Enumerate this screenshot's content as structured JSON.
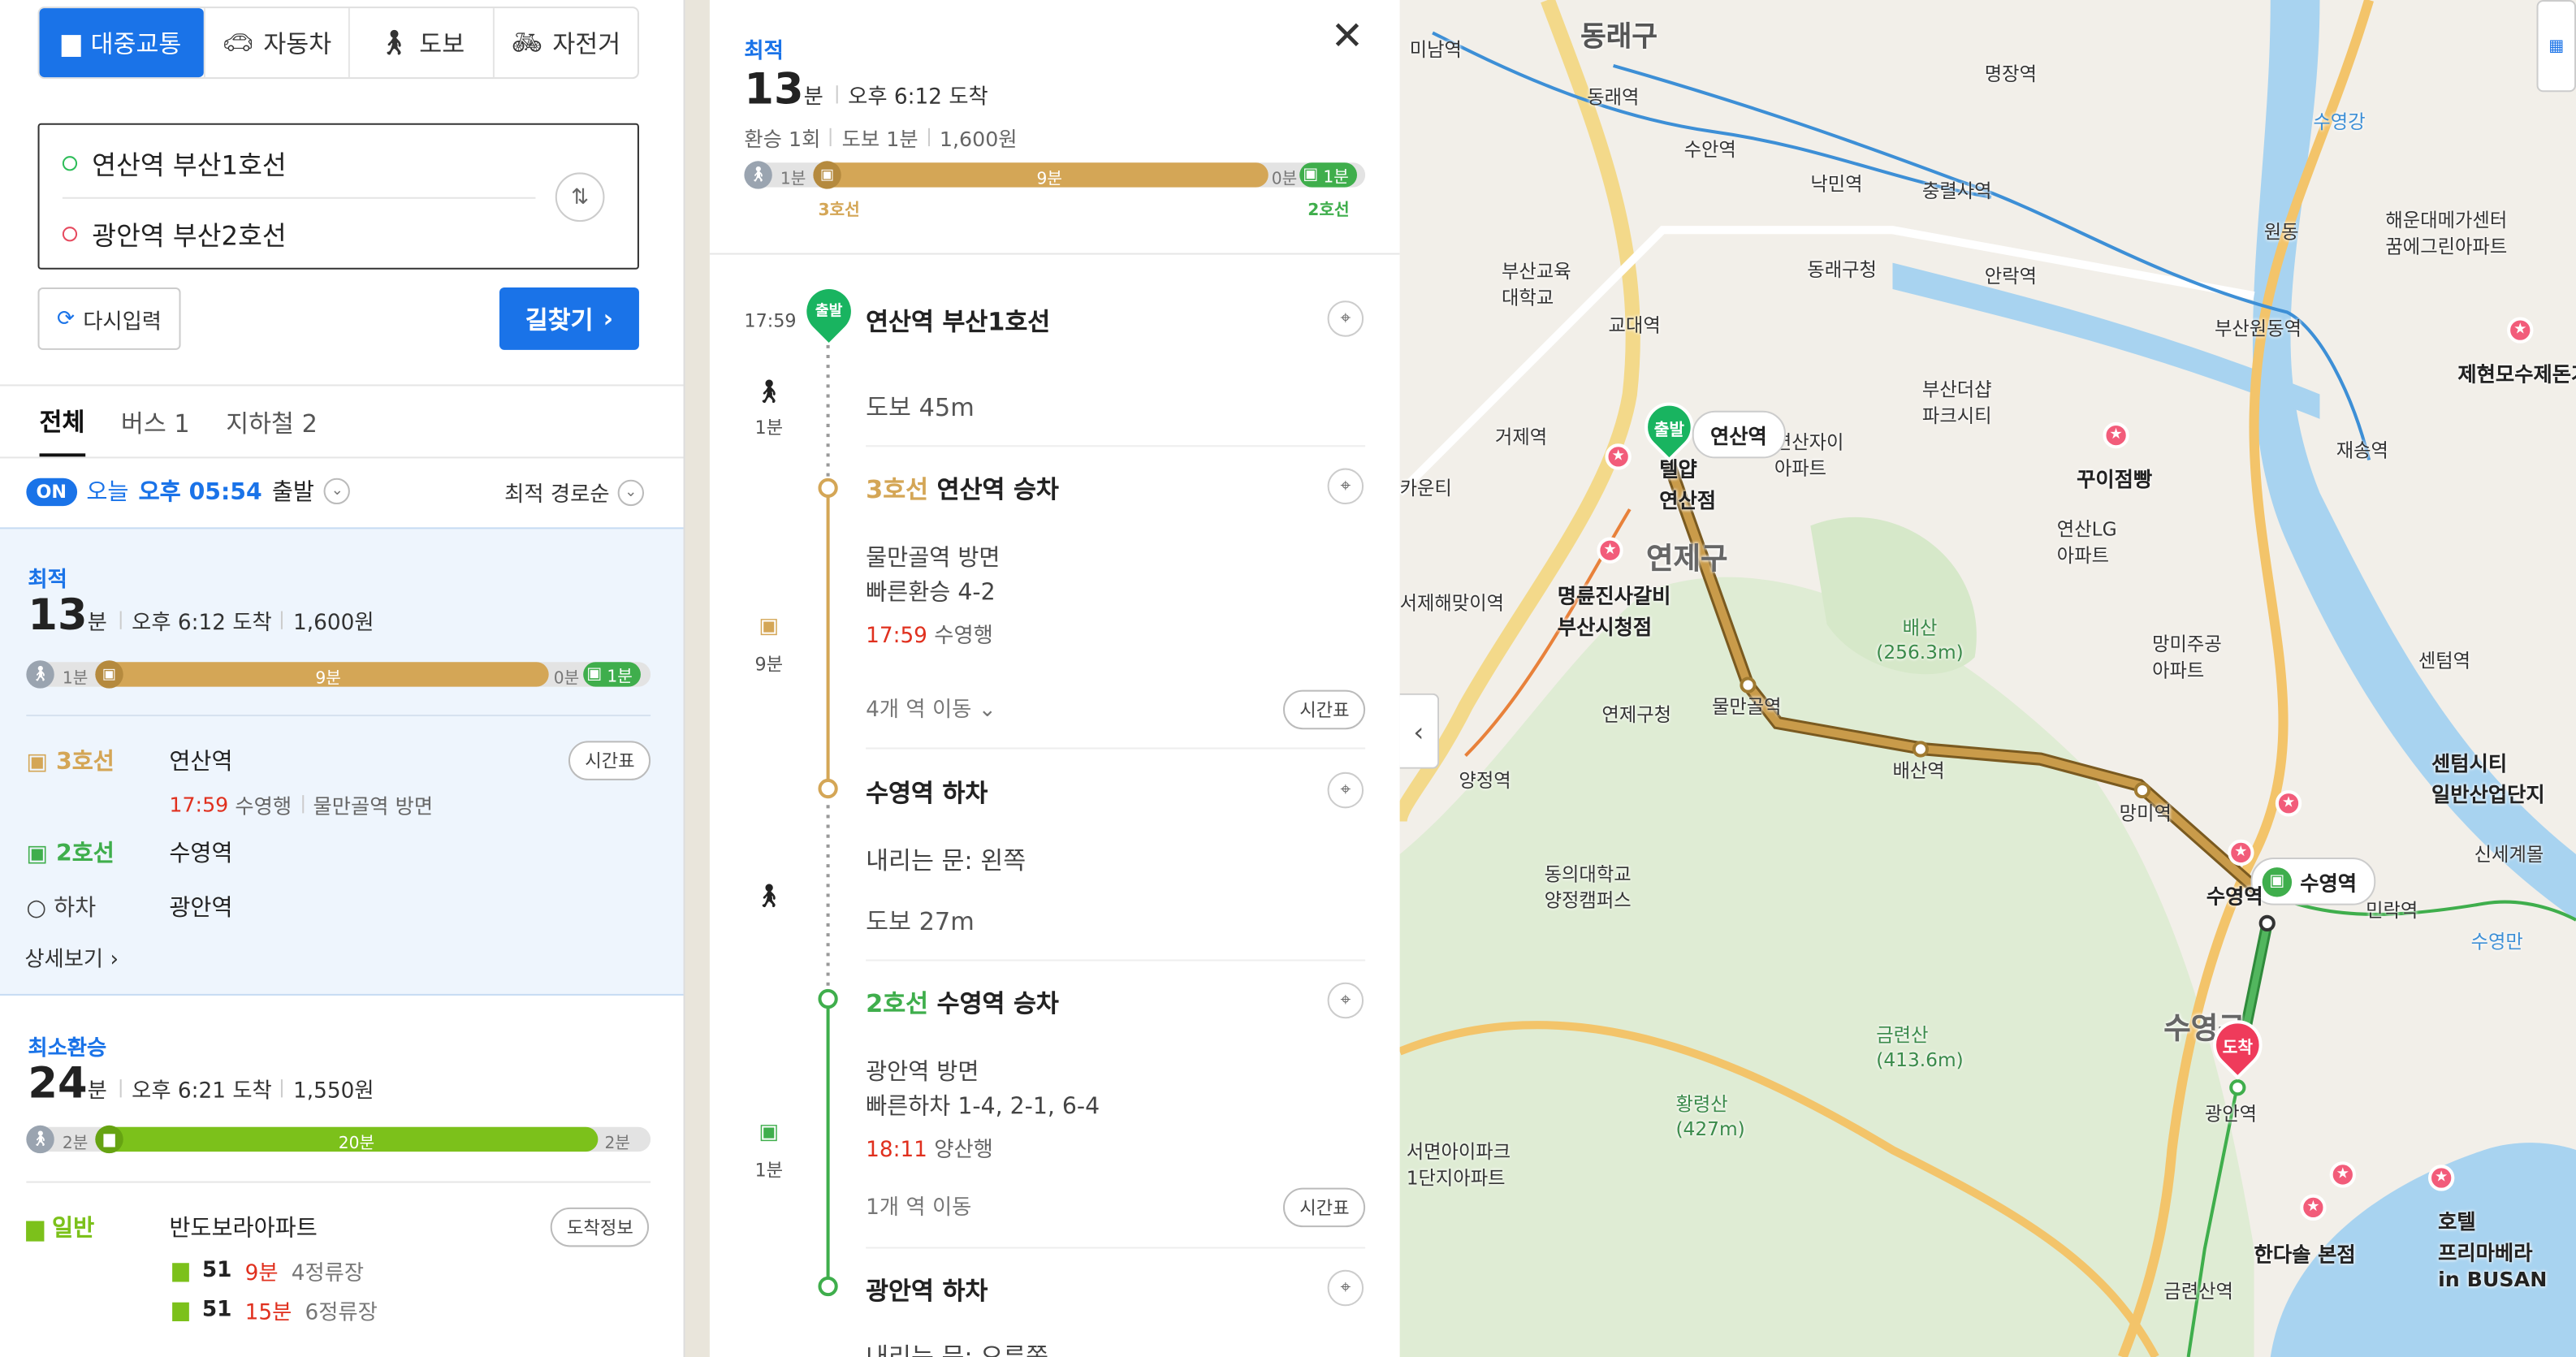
{
  "modes": [
    {
      "icon": "bus-icon",
      "label": "대중교통"
    },
    {
      "icon": "car-icon",
      "label": "자동차"
    },
    {
      "icon": "walk-icon",
      "label": "도보"
    },
    {
      "icon": "bicycle-icon",
      "label": "자전거"
    }
  ],
  "route": {
    "origin": "연산역 부산1호선",
    "destination": "광안역 부산2호선",
    "reset_label": "다시입력",
    "search_label": "길찾기"
  },
  "tabs": [
    "전체",
    "버스 1",
    "지하철 2"
  ],
  "departure": {
    "on": "ON",
    "text_today": "오늘",
    "time": "오후 05:54",
    "suffix": "출발",
    "sort": "최적 경로순"
  },
  "colors": {
    "blue": "#1a73e8",
    "line3": "#d4a656",
    "line2": "#3fae4c",
    "bus": "#7cc11b",
    "red": "#e0301e"
  },
  "results": [
    {
      "label": "최적",
      "minutes": "13",
      "unit": "분",
      "arrive": "오후 6:12 도착",
      "fare": "1,600원",
      "bar": {
        "walk1": "1분",
        "ride": "9분",
        "wait": "0분",
        "walk2": "1분"
      },
      "legs": [
        {
          "line": "3호선",
          "station": "연산역",
          "time": "17:59",
          "dir": "수영행",
          "extra": "물만골역 방면",
          "button": "시간표"
        },
        {
          "line": "2호선",
          "station": "수영역"
        },
        {
          "line": "하차",
          "station": "광안역"
        }
      ],
      "more": "상세보기"
    },
    {
      "label": "최소환승",
      "minutes": "24",
      "unit": "분",
      "arrive": "오후 6:21 도착",
      "fare": "1,550원",
      "bar": {
        "walk1": "2분",
        "ride": "20분",
        "walk2": "2분"
      },
      "legs": [
        {
          "line": "일반",
          "station": "반도보라아파트",
          "button": "도착정보",
          "buses": [
            {
              "no": "51",
              "min": "9분",
              "stops": "4정류장"
            },
            {
              "no": "51",
              "min": "15분",
              "stops": "6정류장"
            }
          ]
        }
      ]
    }
  ],
  "detail": {
    "label": "최적",
    "minutes": "13",
    "unit": "분",
    "arrive": "오후 6:12 도착",
    "transfer": "환승 1회",
    "walk": "도보 1분",
    "fare": "1,600원",
    "bar": {
      "walk1": "1분",
      "ride": "9분",
      "wait": "0분",
      "walk2": "1분",
      "line_a": "3호선",
      "line_b": "2호선"
    },
    "start_time": "17:59",
    "start_badge": "출발",
    "steps": {
      "start": "연산역 부산1호선",
      "walk1": {
        "time": "1분",
        "text": "도보 45m"
      },
      "board1": {
        "line": "3호선",
        "station": "연산역 승차",
        "dir": "물만골역 방면",
        "fast": "빠른환승 4-2",
        "time": "17:59",
        "bound": "수영행",
        "stops": "4개 역 이동",
        "button": "시간표",
        "ride": "9분"
      },
      "alight1": {
        "station": "수영역 하차",
        "door": "내리는 문: 왼쪽",
        "walk": "도보 27m"
      },
      "board2": {
        "line": "2호선",
        "station": "수영역 승차",
        "dir": "광안역 방면",
        "fast": "빠른하차 1-4, 2-1, 6-4",
        "time": "18:11",
        "bound": "양산행",
        "stops": "1개 역 이동",
        "button": "시간표",
        "ride": "1분"
      },
      "alight2": {
        "station": "광안역 하차",
        "door": "내리는 문: 오른쪽"
      }
    }
  },
  "map": {
    "labels": {
      "dongnae": "동래구",
      "yeonje": "연제구",
      "suyeong": "수영구",
      "minam": "미남역",
      "dongnae_st": "동래역",
      "myeongjang": "명장역",
      "suan": "수안역",
      "nakmin": "낙민역",
      "chungnyeolsa": "충렬사역",
      "dongnaegu_office": "동래구청",
      "anrak": "안락역",
      "gyodae": "교대역",
      "geoje": "거제역",
      "yeonsan": "연산역",
      "mulmangol": "물만골역",
      "baesan": "배산역",
      "mangmi": "망미역",
      "suyeong_st": "수영역",
      "gwangan": "광안역",
      "millak": "민락역",
      "geumnyeonsan_st": "금련산역",
      "busanwondong": "부산원동역",
      "jaesong": "재송역",
      "yangjeong": "양정역",
      "yeonjegu_office": "연제구청",
      "baesan_mt": "배산\n(256.3m)",
      "geumnyeonsan": "금련산\n(413.6m)",
      "hwangnyeongsan": "황령산\n(427m)",
      "myeongryun": "명륜진사갈비\n부산시청점",
      "ggoi": "꾸이점빵",
      "hotel": "호텔\n프리마베라\nin BUSAN",
      "handasol": "한다솔 본점",
      "start": "출발",
      "arrive": "도착",
      "suyeong_box": "수영역",
      "yeonsan_box": "연산역",
      "jehyeon": "제현모수제돈가",
      "haeundae": "해운대메가센터\n꿈에그린아파트",
      "busan_edu": "부산교육\n대학교",
      "busan_dusan": "부산더샵\n파크시티",
      "yeonsan_LG": "연산LG\n아파트",
      "mangmi_apt": "망미주공\n아파트",
      "dongeui": "동의대학교\n양정캠퍼스",
      "seomyeon": "서면아이파크\n1단지아파트",
      "centum": "센텀역",
      "centum_city": "센텀시티\n일반산업단지",
      "sinsegye": "신세계몰",
      "suyeonggang": "수영강",
      "suyeongdan": "수영만",
      "yeonsanjai": "연산자이\n아파트",
      "mulmangol_label": "물만골역",
      "gwangan_label": "광안역",
      "wondong": "원동",
      "yeonsan_hotel": "텔얍\n연산점",
      "kaunti": "카운티",
      "seomyeon_haema": "서제해맞이역"
    }
  }
}
